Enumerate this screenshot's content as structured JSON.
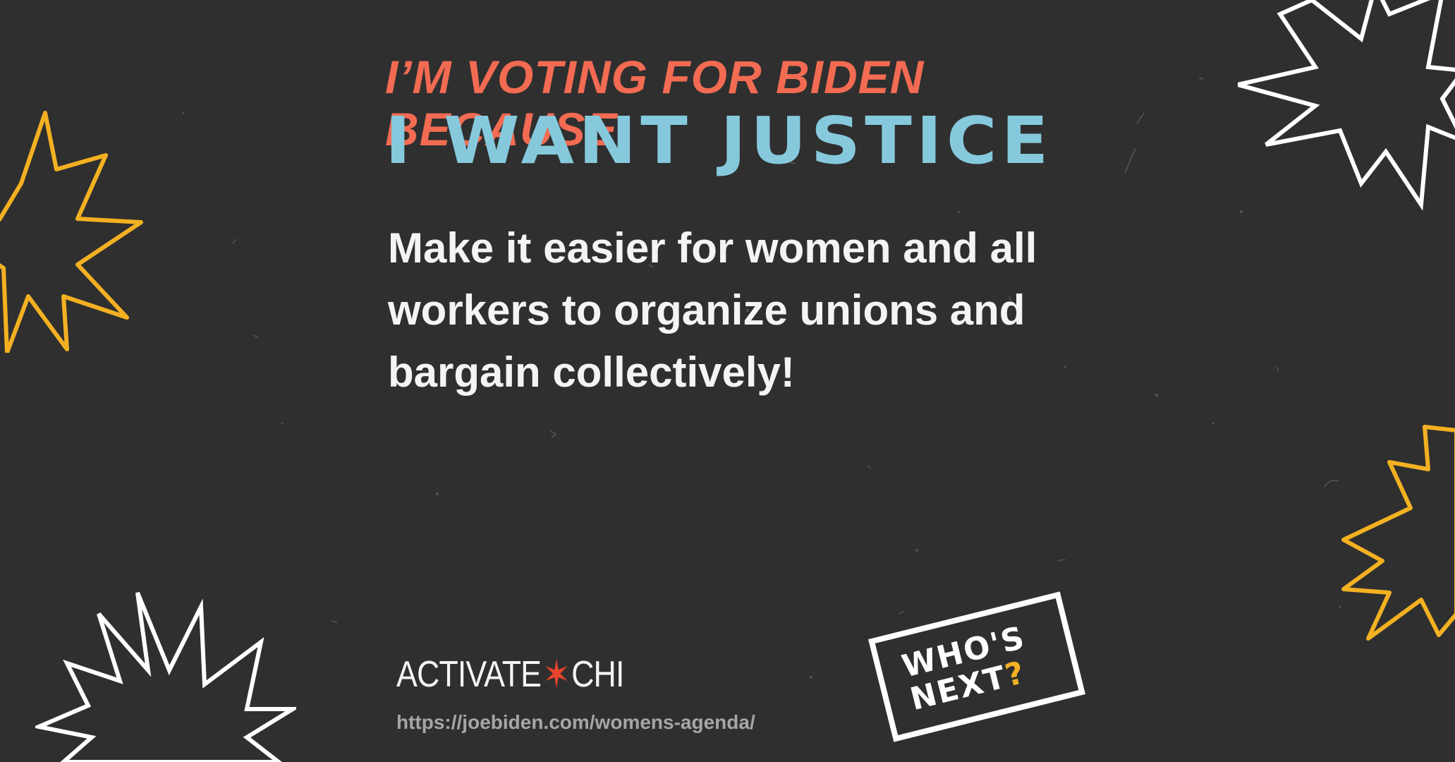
{
  "headline": {
    "intro": "I’M VOTING FOR BIDEN BECAUSE",
    "main": "I WANT JUSTICE"
  },
  "body": {
    "line1": "Make it easier for women and all",
    "line2": "workers to organize unions and",
    "line3": "bargain collectively!"
  },
  "logo": {
    "left": "ACTIVATE",
    "star": "✶",
    "right": "CHI"
  },
  "url": "https://joebiden.com/womens-agenda/",
  "badge": {
    "line1": "WHO'S",
    "line2": "NEXT",
    "mark": "?"
  },
  "colors": {
    "background": "#2f2f2f",
    "headline_intro": "#f26b52",
    "headline_main": "#86c9dd",
    "body_text": "#f4f4f4",
    "accent_yellow": "#f3b122",
    "logo_star": "#e8442c",
    "url": "#a6a6a6"
  },
  "icons": [
    "star-burst-icon"
  ]
}
